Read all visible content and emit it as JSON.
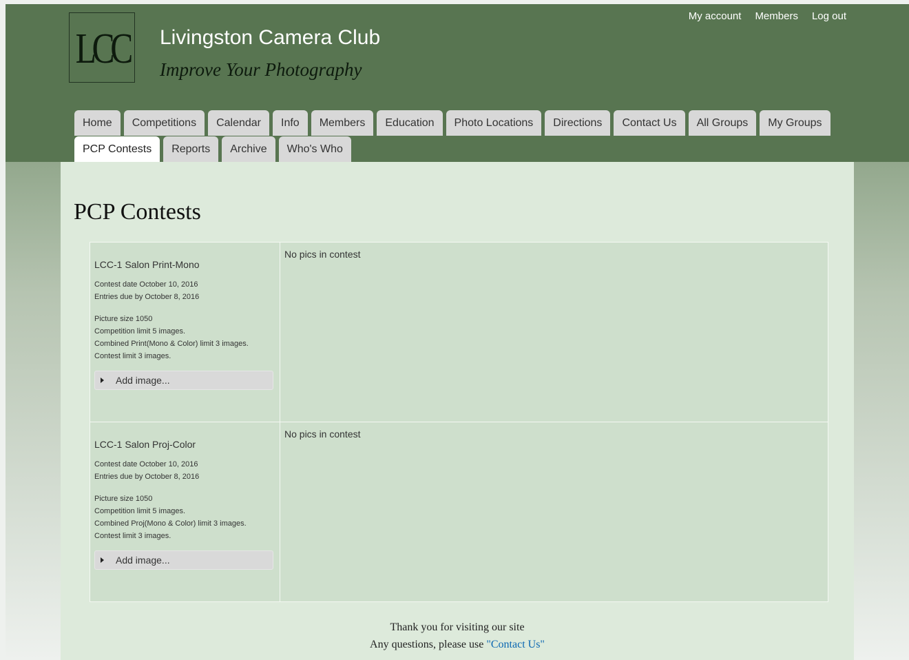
{
  "site": {
    "logo_text": "LCC",
    "title": "Livingston Camera Club",
    "slogan": "Improve Your Photography"
  },
  "user_menu": {
    "my_account": "My account",
    "members": "Members",
    "log_out": "Log out"
  },
  "nav": {
    "tabs_row1": [
      "Home",
      "Competitions",
      "Calendar",
      "Info",
      "Members",
      "Education",
      "Photo Locations",
      "Directions",
      "Contact Us",
      "All Groups",
      "My Groups"
    ],
    "tabs_row2": [
      "PCP Contests",
      "Reports",
      "Archive",
      "Who's Who"
    ],
    "active": "PCP Contests"
  },
  "page": {
    "title": "PCP Contests"
  },
  "contests": [
    {
      "name": "LCC-1 Salon Print-Mono",
      "contest_date": "Contest date October 10, 2016",
      "entries_due": "Entries due by October 8, 2016",
      "picture_size": "Picture size 1050",
      "competition_limit": "Competition limit 5 images.",
      "combined_limit": "Combined Print(Mono & Color) limit 3 images.",
      "contest_limit": "Contest limit 3 images.",
      "add_image_label": "Add image...",
      "pics_status": "No pics in contest"
    },
    {
      "name": "LCC-1 Salon Proj-Color",
      "contest_date": "Contest date October 10, 2016",
      "entries_due": "Entries due by October 8, 2016",
      "picture_size": "Picture size 1050",
      "competition_limit": "Competition limit 5 images.",
      "combined_limit": "Combined Proj(Mono & Color) limit 3 images.",
      "contest_limit": "Contest limit 3 images.",
      "add_image_label": "Add image...",
      "pics_status": "No pics in contest"
    }
  ],
  "footer": {
    "line1": "Thank you for visiting our site",
    "line2_prefix": "Any questions, please use ",
    "contact_link": "\"Contact Us\""
  },
  "colors": {
    "header_green": "#587551",
    "content_bg": "#ddeadb",
    "table_bg": "#cedfcc",
    "tab_bg": "#d8d8d8",
    "link_blue": "#0b67b2"
  }
}
